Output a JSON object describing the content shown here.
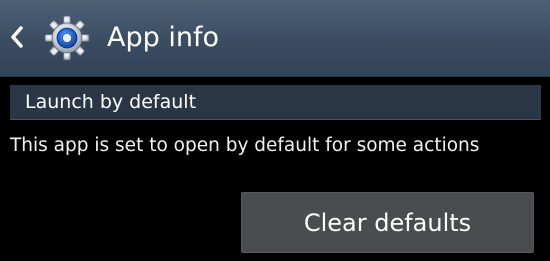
{
  "action_bar": {
    "title": "App info",
    "back_icon": "chevron-left-icon",
    "app_icon": "settings-gear-icon",
    "background_color": "#3f5167"
  },
  "section": {
    "header": "Launch by default",
    "description": "This app is set to open by default for some actions"
  },
  "actions": {
    "clear_defaults_label": "Clear defaults"
  }
}
